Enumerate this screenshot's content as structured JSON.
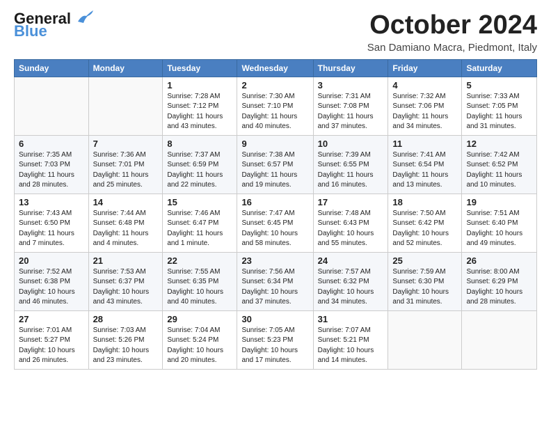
{
  "header": {
    "logo_line1": "General",
    "logo_line2": "Blue",
    "month_title": "October 2024",
    "location": "San Damiano Macra, Piedmont, Italy"
  },
  "weekdays": [
    "Sunday",
    "Monday",
    "Tuesday",
    "Wednesday",
    "Thursday",
    "Friday",
    "Saturday"
  ],
  "weeks": [
    [
      {
        "day": "",
        "info": ""
      },
      {
        "day": "",
        "info": ""
      },
      {
        "day": "1",
        "info": "Sunrise: 7:28 AM\nSunset: 7:12 PM\nDaylight: 11 hours and 43 minutes."
      },
      {
        "day": "2",
        "info": "Sunrise: 7:30 AM\nSunset: 7:10 PM\nDaylight: 11 hours and 40 minutes."
      },
      {
        "day": "3",
        "info": "Sunrise: 7:31 AM\nSunset: 7:08 PM\nDaylight: 11 hours and 37 minutes."
      },
      {
        "day": "4",
        "info": "Sunrise: 7:32 AM\nSunset: 7:06 PM\nDaylight: 11 hours and 34 minutes."
      },
      {
        "day": "5",
        "info": "Sunrise: 7:33 AM\nSunset: 7:05 PM\nDaylight: 11 hours and 31 minutes."
      }
    ],
    [
      {
        "day": "6",
        "info": "Sunrise: 7:35 AM\nSunset: 7:03 PM\nDaylight: 11 hours and 28 minutes."
      },
      {
        "day": "7",
        "info": "Sunrise: 7:36 AM\nSunset: 7:01 PM\nDaylight: 11 hours and 25 minutes."
      },
      {
        "day": "8",
        "info": "Sunrise: 7:37 AM\nSunset: 6:59 PM\nDaylight: 11 hours and 22 minutes."
      },
      {
        "day": "9",
        "info": "Sunrise: 7:38 AM\nSunset: 6:57 PM\nDaylight: 11 hours and 19 minutes."
      },
      {
        "day": "10",
        "info": "Sunrise: 7:39 AM\nSunset: 6:55 PM\nDaylight: 11 hours and 16 minutes."
      },
      {
        "day": "11",
        "info": "Sunrise: 7:41 AM\nSunset: 6:54 PM\nDaylight: 11 hours and 13 minutes."
      },
      {
        "day": "12",
        "info": "Sunrise: 7:42 AM\nSunset: 6:52 PM\nDaylight: 11 hours and 10 minutes."
      }
    ],
    [
      {
        "day": "13",
        "info": "Sunrise: 7:43 AM\nSunset: 6:50 PM\nDaylight: 11 hours and 7 minutes."
      },
      {
        "day": "14",
        "info": "Sunrise: 7:44 AM\nSunset: 6:48 PM\nDaylight: 11 hours and 4 minutes."
      },
      {
        "day": "15",
        "info": "Sunrise: 7:46 AM\nSunset: 6:47 PM\nDaylight: 11 hours and 1 minute."
      },
      {
        "day": "16",
        "info": "Sunrise: 7:47 AM\nSunset: 6:45 PM\nDaylight: 10 hours and 58 minutes."
      },
      {
        "day": "17",
        "info": "Sunrise: 7:48 AM\nSunset: 6:43 PM\nDaylight: 10 hours and 55 minutes."
      },
      {
        "day": "18",
        "info": "Sunrise: 7:50 AM\nSunset: 6:42 PM\nDaylight: 10 hours and 52 minutes."
      },
      {
        "day": "19",
        "info": "Sunrise: 7:51 AM\nSunset: 6:40 PM\nDaylight: 10 hours and 49 minutes."
      }
    ],
    [
      {
        "day": "20",
        "info": "Sunrise: 7:52 AM\nSunset: 6:38 PM\nDaylight: 10 hours and 46 minutes."
      },
      {
        "day": "21",
        "info": "Sunrise: 7:53 AM\nSunset: 6:37 PM\nDaylight: 10 hours and 43 minutes."
      },
      {
        "day": "22",
        "info": "Sunrise: 7:55 AM\nSunset: 6:35 PM\nDaylight: 10 hours and 40 minutes."
      },
      {
        "day": "23",
        "info": "Sunrise: 7:56 AM\nSunset: 6:34 PM\nDaylight: 10 hours and 37 minutes."
      },
      {
        "day": "24",
        "info": "Sunrise: 7:57 AM\nSunset: 6:32 PM\nDaylight: 10 hours and 34 minutes."
      },
      {
        "day": "25",
        "info": "Sunrise: 7:59 AM\nSunset: 6:30 PM\nDaylight: 10 hours and 31 minutes."
      },
      {
        "day": "26",
        "info": "Sunrise: 8:00 AM\nSunset: 6:29 PM\nDaylight: 10 hours and 28 minutes."
      }
    ],
    [
      {
        "day": "27",
        "info": "Sunrise: 7:01 AM\nSunset: 5:27 PM\nDaylight: 10 hours and 26 minutes."
      },
      {
        "day": "28",
        "info": "Sunrise: 7:03 AM\nSunset: 5:26 PM\nDaylight: 10 hours and 23 minutes."
      },
      {
        "day": "29",
        "info": "Sunrise: 7:04 AM\nSunset: 5:24 PM\nDaylight: 10 hours and 20 minutes."
      },
      {
        "day": "30",
        "info": "Sunrise: 7:05 AM\nSunset: 5:23 PM\nDaylight: 10 hours and 17 minutes."
      },
      {
        "day": "31",
        "info": "Sunrise: 7:07 AM\nSunset: 5:21 PM\nDaylight: 10 hours and 14 minutes."
      },
      {
        "day": "",
        "info": ""
      },
      {
        "day": "",
        "info": ""
      }
    ]
  ]
}
